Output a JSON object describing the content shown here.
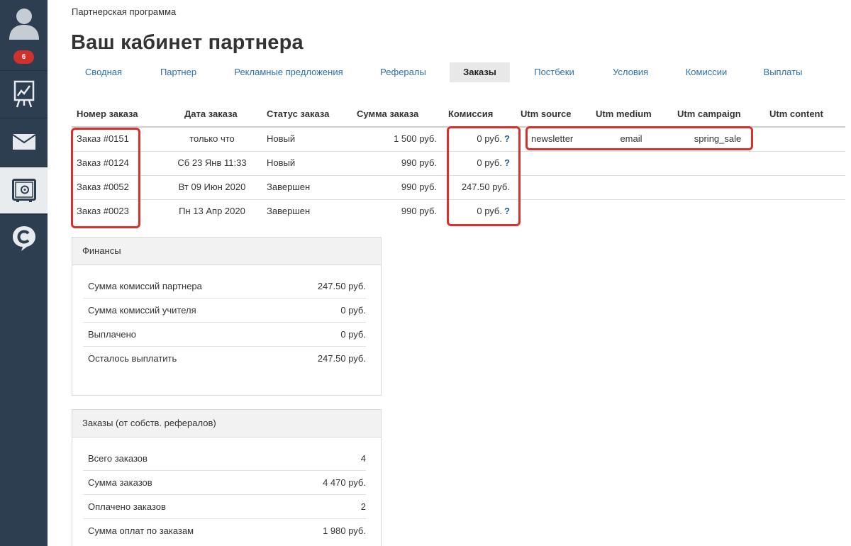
{
  "sidebar": {
    "badge_count": "6"
  },
  "breadcrumb": "Партнерская программа",
  "page_title": "Ваш кабинет партнера",
  "tabs": [
    {
      "label": "Сводная"
    },
    {
      "label": "Партнер"
    },
    {
      "label": "Рекламные предложения"
    },
    {
      "label": "Рефералы"
    },
    {
      "label": "Заказы",
      "active": true
    },
    {
      "label": "Постбеки"
    },
    {
      "label": "Условия"
    },
    {
      "label": "Комиссии"
    },
    {
      "label": "Выплаты"
    }
  ],
  "orders_table": {
    "columns": [
      "Номер заказа",
      "Дата заказа",
      "Статус заказа",
      "Сумма заказа",
      "Комиссия",
      "Utm source",
      "Utm medium",
      "Utm campaign",
      "Utm content"
    ],
    "rows": [
      {
        "number": "Заказ #0151",
        "date": "только что",
        "status": "Новый",
        "sum": "1 500 руб.",
        "commission": "0 руб.",
        "help": "?",
        "utm_source": "newsletter",
        "utm_medium": "email",
        "utm_campaign": "spring_sale"
      },
      {
        "number": "Заказ #0124",
        "date": "Сб 23 Янв 11:33",
        "status": "Новый",
        "sum": "990 руб.",
        "commission": "0 руб.",
        "help": "?"
      },
      {
        "number": "Заказ #0052",
        "date": "Вт 09 Июн 2020",
        "status": "Завершен",
        "sum": "990 руб.",
        "commission": "247.50 руб."
      },
      {
        "number": "Заказ #0023",
        "date": "Пн 13 Апр 2020",
        "status": "Завершен",
        "sum": "990 руб.",
        "commission": "0 руб.",
        "help": "?"
      }
    ]
  },
  "finance_panel": {
    "title": "Финансы",
    "rows": [
      {
        "label": "Сумма комиссий партнера",
        "value": "247.50 руб."
      },
      {
        "label": "Сумма комиссий учителя",
        "value": "0 руб."
      },
      {
        "label": "Выплачено",
        "value": "0 руб."
      },
      {
        "label": "Осталось выплатить",
        "value": "247.50 руб."
      }
    ]
  },
  "orders_panel": {
    "title": "Заказы (от собств. рефералов)",
    "rows": [
      {
        "label": "Всего заказов",
        "value": "4"
      },
      {
        "label": "Сумма заказов",
        "value": "4 470 руб."
      },
      {
        "label": "Оплачено заказов",
        "value": "2"
      },
      {
        "label": "Сумма оплат по заказам",
        "value": "1 980 руб."
      }
    ]
  },
  "colors": {
    "sidebar_bg": "#2c3e50",
    "link": "#2c6fb0",
    "highlight": "#d9302c",
    "badge": "#d0312d"
  }
}
